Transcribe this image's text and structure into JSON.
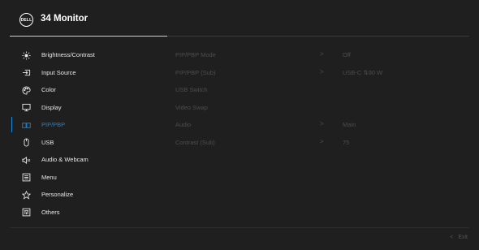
{
  "header": {
    "logo_text": "DELL",
    "title": "34 Monitor"
  },
  "menu": {
    "items": [
      {
        "label": "Brightness/Contrast",
        "icon": "brightness-icon",
        "active": false
      },
      {
        "label": "Input Source",
        "icon": "input-source-icon",
        "active": false
      },
      {
        "label": "Color",
        "icon": "color-palette-icon",
        "active": false
      },
      {
        "label": "Display",
        "icon": "display-icon",
        "active": false
      },
      {
        "label": "PIP/PBP",
        "icon": "pip-pbp-icon",
        "active": true
      },
      {
        "label": "USB",
        "icon": "usb-mouse-icon",
        "active": false
      },
      {
        "label": "Audio & Webcam",
        "icon": "audio-webcam-icon",
        "active": false
      },
      {
        "label": "Menu",
        "icon": "menu-list-icon",
        "active": false
      },
      {
        "label": "Personalize",
        "icon": "star-icon",
        "active": false
      },
      {
        "label": "Others",
        "icon": "others-icon",
        "active": false
      }
    ]
  },
  "submenu": {
    "rows": [
      {
        "label": "PIP/PBP Mode",
        "arrow": ">",
        "value": "Off"
      },
      {
        "label": "PIP/PBP (Sub)",
        "arrow": ">",
        "value": "USB-C ⇅90 W"
      },
      {
        "label": "USB Switch",
        "arrow": "",
        "value": ""
      },
      {
        "label": "Video Swap",
        "arrow": "",
        "value": ""
      },
      {
        "label": "Audio",
        "arrow": ">",
        "value": "Main"
      },
      {
        "label": "Contrast (Sub)",
        "arrow": ">",
        "value": "75"
      }
    ]
  },
  "footer": {
    "exit_arrow": "<",
    "exit_label": "Exit"
  },
  "colors": {
    "background": "#1f1f1f",
    "accent": "#1e84d4",
    "text": "#e8e8e8",
    "disabled": "#4d4d4d"
  }
}
